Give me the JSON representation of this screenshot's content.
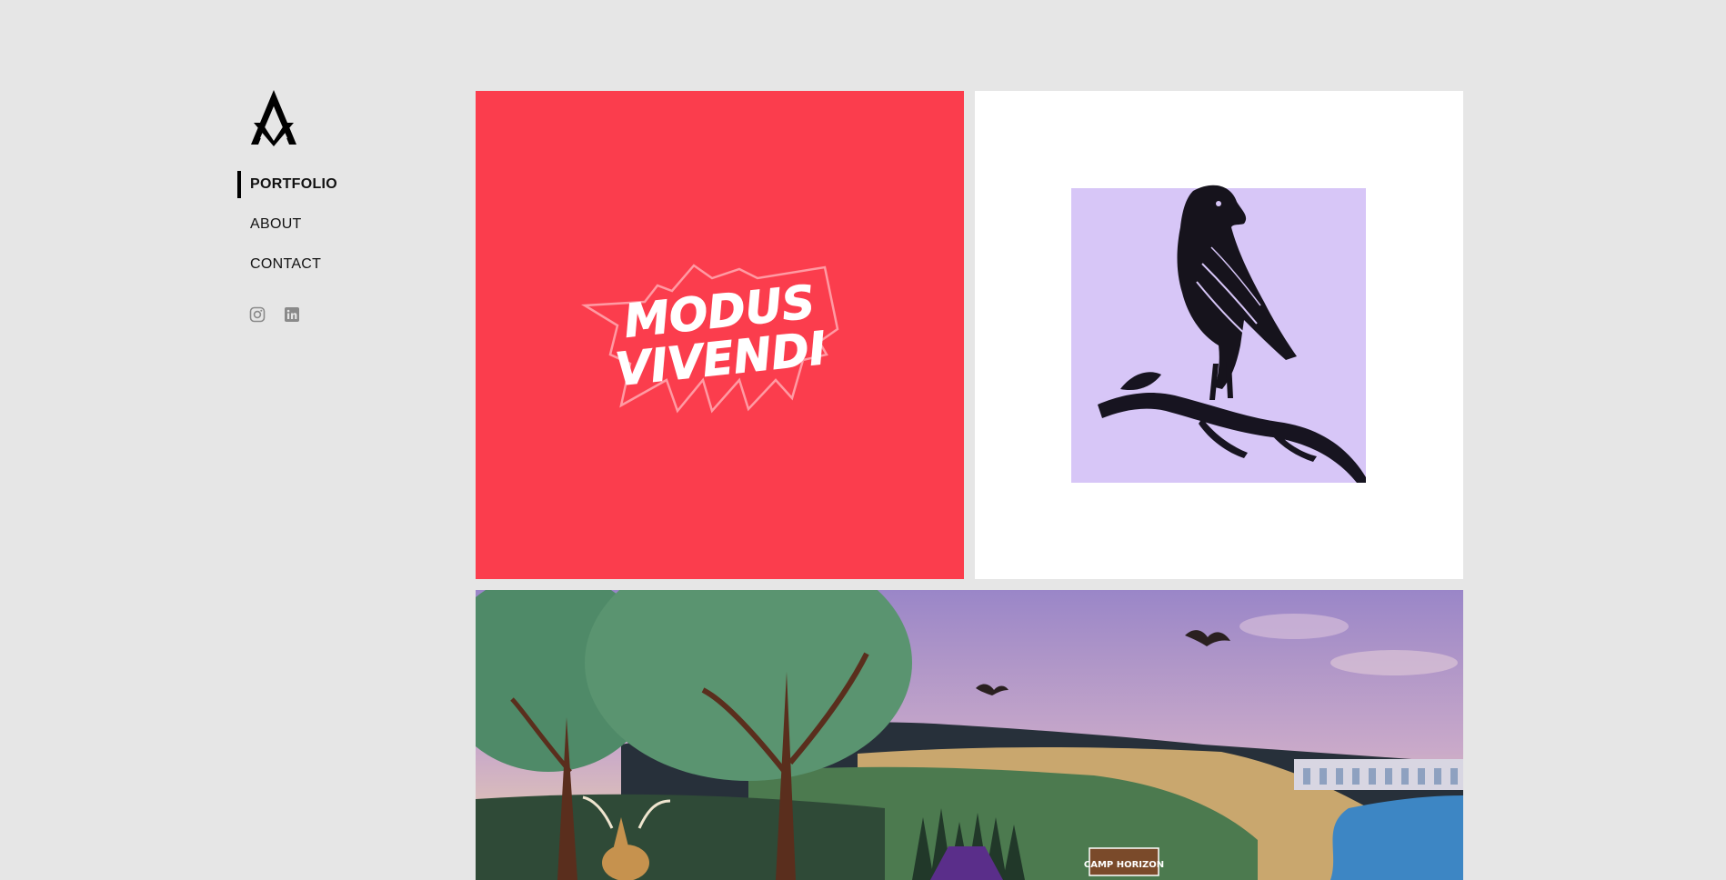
{
  "brand": {
    "logo_icon": "aa-monogram-logo"
  },
  "nav": {
    "items": [
      {
        "label": "PORTFOLIO",
        "active": true
      },
      {
        "label": "ABOUT",
        "active": false
      },
      {
        "label": "CONTACT",
        "active": false
      }
    ]
  },
  "social": [
    {
      "icon": "instagram-icon"
    },
    {
      "icon": "linkedin-icon"
    }
  ],
  "portfolio": {
    "tiles": [
      {
        "artwork_text_line1": "MODUS",
        "artwork_text_line2": "VIVENDI",
        "bg_color": "#fb3d4d"
      },
      {
        "subject": "crow-on-branch-illustration",
        "bg_color": "#ffffff",
        "art_bg": "#d7c6f7"
      },
      {
        "subject": "forest-landscape-illustration",
        "sign_text": "CAMP HORIZON"
      }
    ]
  },
  "colors": {
    "page_bg": "#e6e6e6",
    "nav_text": "#111111",
    "icon_gray": "#8a8a8a"
  }
}
